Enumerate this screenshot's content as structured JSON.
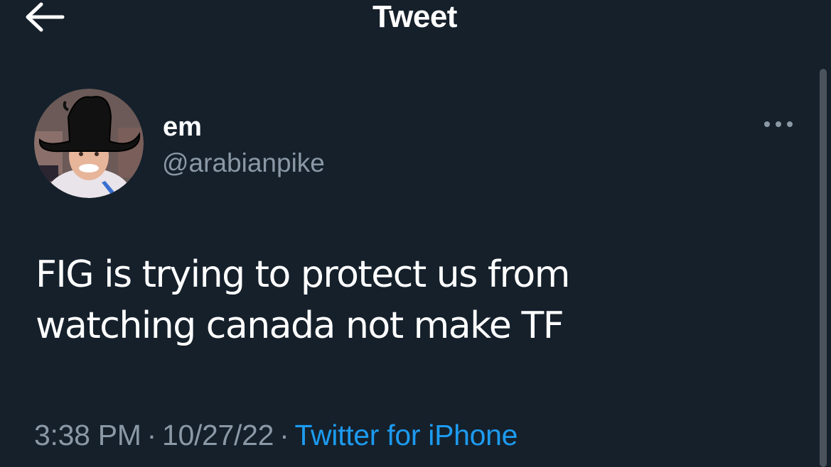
{
  "header": {
    "title": "Tweet",
    "back_icon": "arrow-left-icon"
  },
  "author": {
    "display_name": "em",
    "handle": "@arabianpike",
    "avatar_icon": "avatar-photo"
  },
  "more_icon": "more-horizontal-icon",
  "tweet": {
    "text": "FIG is trying to protect us from\nwatching canada not make TF"
  },
  "meta": {
    "time": "3:38 PM",
    "separator": "·",
    "date": "10/27/22",
    "source": "Twitter for iPhone"
  },
  "colors": {
    "background": "#15202b",
    "text": "#ffffff",
    "secondary": "#8b98a5",
    "accent": "#1d9bf0"
  }
}
